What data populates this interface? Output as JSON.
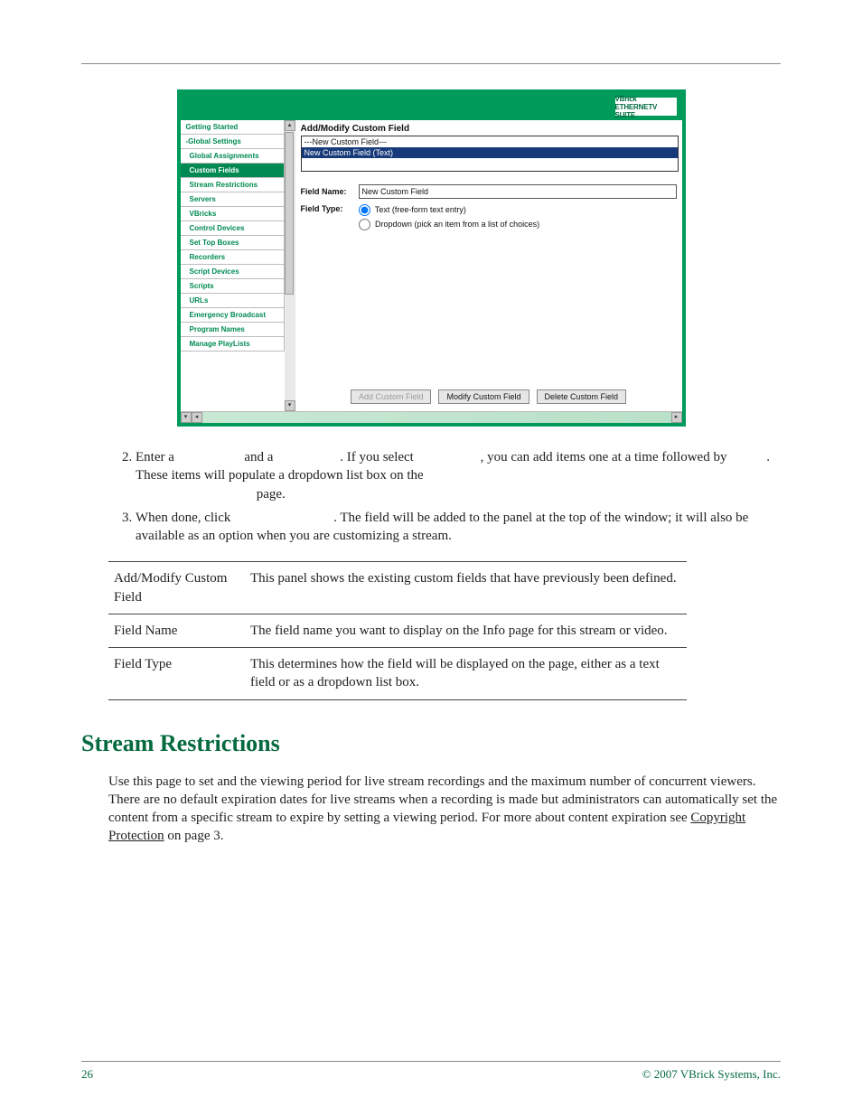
{
  "header_logo": "VBrick ETHERNETV SUITE",
  "shot": {
    "title": "Add/Modify Custom Field",
    "list_items": [
      "---New Custom Field---",
      "New Custom Field (Text)"
    ],
    "field_name_label": "Field Name:",
    "field_name_value": "New Custom Field",
    "field_type_label": "Field Type:",
    "radio_text": "Text (free-form text entry)",
    "radio_dropdown": "Dropdown (pick an item from a list of choices)",
    "btn_add": "Add Custom Field",
    "btn_modify": "Modify Custom Field",
    "btn_delete": "Delete Custom Field"
  },
  "sidebar": {
    "items": [
      {
        "label": "Getting Started",
        "type": "node"
      },
      {
        "label": "-Global Settings",
        "type": "node"
      },
      {
        "label": "Global Assignments",
        "type": "leaf"
      },
      {
        "label": "Custom Fields",
        "type": "active"
      },
      {
        "label": "Stream Restrictions",
        "type": "leaf"
      },
      {
        "label": "Servers",
        "type": "leaf"
      },
      {
        "label": "VBricks",
        "type": "leaf"
      },
      {
        "label": "Control Devices",
        "type": "leaf"
      },
      {
        "label": "Set Top Boxes",
        "type": "leaf"
      },
      {
        "label": "Recorders",
        "type": "leaf"
      },
      {
        "label": "Script Devices",
        "type": "leaf"
      },
      {
        "label": "Scripts",
        "type": "leaf"
      },
      {
        "label": "URLs",
        "type": "leaf"
      },
      {
        "label": "Emergency Broadcast",
        "type": "leaf"
      },
      {
        "label": "Program Names",
        "type": "leaf"
      },
      {
        "label": "Manage PlayLists",
        "type": "leaf"
      }
    ]
  },
  "steps": {
    "s2a": "Enter a ",
    "s2b": " and a ",
    "s2c": ". If you select ",
    "s2d": ", you can add items one at a time followed by ",
    "s2e": ". These items will populate a dropdown list box on the ",
    "s2f": " page.",
    "s3a": "When done, click ",
    "s3b": ". The field will be added to the panel at the top of the window; it will also be available as an option when you are customizing a stream."
  },
  "defs": [
    {
      "term": "Add/Modify Custom Field",
      "desc": "This panel shows the existing custom fields that have previously been defined."
    },
    {
      "term": "Field Name",
      "desc": "The field name you want to display on the Info page for this stream or video."
    },
    {
      "term": "Field Type",
      "desc": "This determines how the field will be displayed on the                      page, either as a text field or as a dropdown list box."
    }
  ],
  "section_heading": "Stream Restrictions",
  "section_para_a": "Use this page to set and the viewing period for live stream recordings and the maximum number of concurrent viewers. There are no default expiration dates for live streams when a recording is made but administrators can automatically set the content from a specific stream to expire by setting a viewing period. For more about content expiration see ",
  "section_link": "Copyright Protection",
  "section_para_b": " on page 3.",
  "footer_left": "26",
  "footer_right": "© 2007 VBrick Systems, Inc."
}
